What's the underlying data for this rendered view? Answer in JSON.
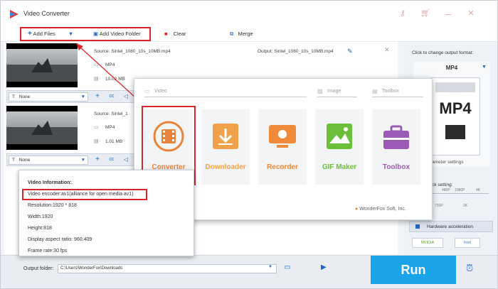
{
  "app": {
    "title": "Video Converter"
  },
  "toolbar": {
    "add_files": "Add Files",
    "add_folder": "Add Video Folder",
    "clear": "Clear",
    "merge": "Merge"
  },
  "files": [
    {
      "source": "Source: Sintel_1080_10s_10MB.mp4",
      "output": "Output: Sintel_1080_10s_10MB.mp4",
      "format": "MP4",
      "size": "10.02 MB",
      "subtitle": "None"
    },
    {
      "source": "Source: Sintel_1",
      "format": "MP4",
      "size": "1.01 MB",
      "subtitle": "None"
    }
  ],
  "popup": {
    "sections": {
      "video": "Video",
      "image": "Image",
      "toolbox": "Toolbox"
    },
    "tiles": [
      {
        "label": "Converter",
        "color": "#e8833a"
      },
      {
        "label": "Downloader",
        "color": "#f0a24a"
      },
      {
        "label": "Recorder",
        "color": "#f08a3a"
      },
      {
        "label": "GIF Maker",
        "color": "#6bbf3a"
      },
      {
        "label": "Toolbox",
        "color": "#9b5bb5"
      }
    ],
    "brand": "WonderFox Soft, Inc."
  },
  "right_panel": {
    "hint": "Click to change output format:",
    "format": "MP4",
    "format_icon_text": "MP4",
    "param_settings": "Parameter settings",
    "quick_setting": "Quick setting:",
    "res_labels": [
      "480P",
      "1080P",
      "4K"
    ],
    "res_labels_bottom": [
      "720P",
      "2K"
    ],
    "hw_accel": "Hardware acceleration",
    "gpu1": "NVIDIA",
    "gpu2": "Intel"
  },
  "info": {
    "title": "Video Information:",
    "encoder": "Video encoder:av1(alliance for open media av1)",
    "resolution": "Resolution:1920 * 818",
    "width": "Width:1920",
    "height": "Height:818",
    "aspect": "Display aspect ratio: 960:409",
    "framerate": "Frame rate:30 fps"
  },
  "bottom": {
    "output_label": "Output folder:",
    "output_path": "C:\\Users\\WonderFox\\Downloads",
    "run": "Run"
  },
  "colors": {
    "accent": "#1aa4e8",
    "highlight": "#d9252b"
  }
}
